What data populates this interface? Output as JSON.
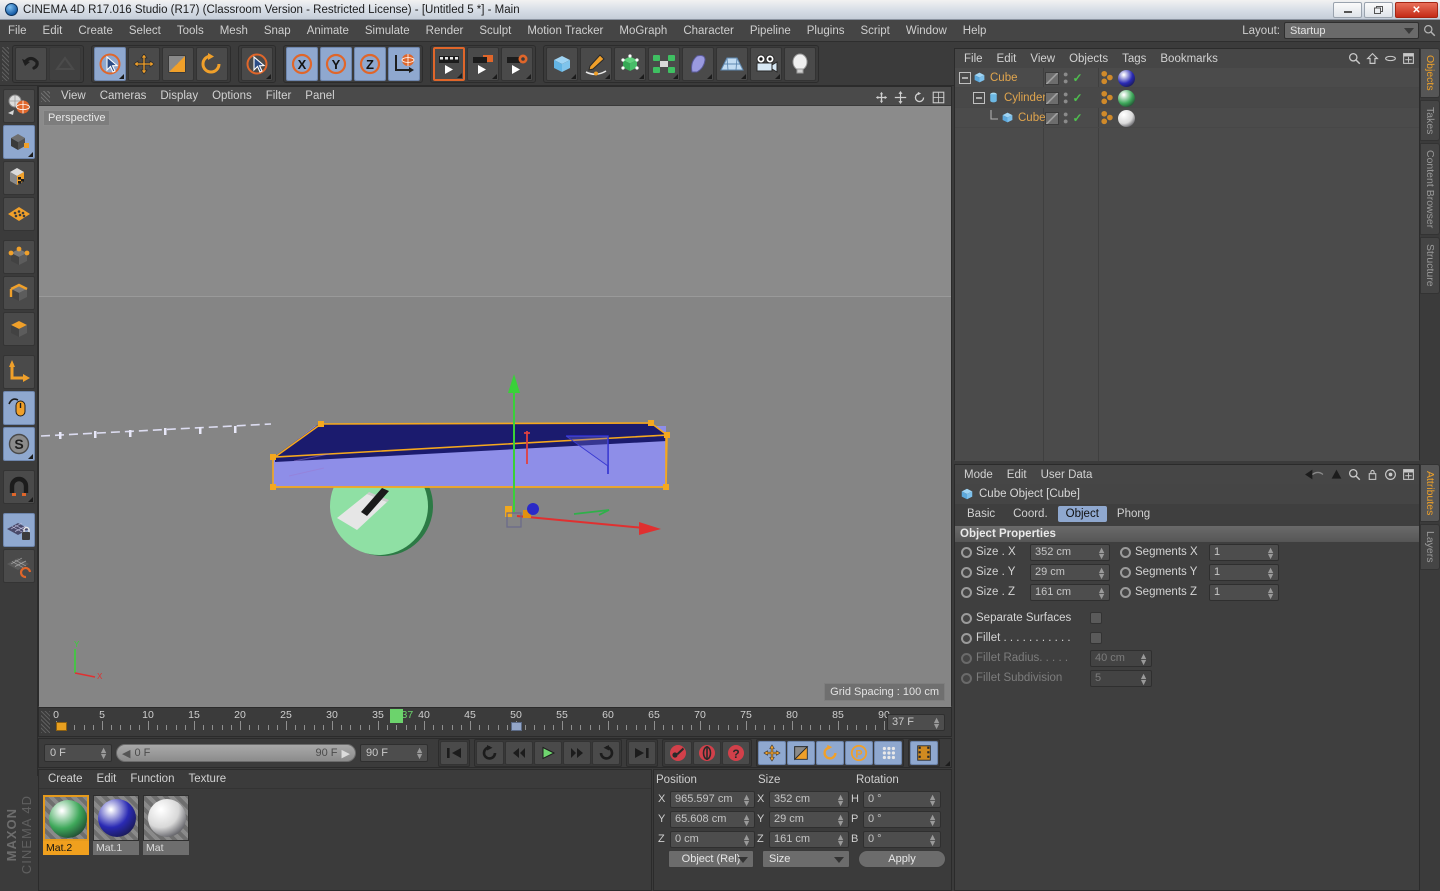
{
  "window": {
    "title": "CINEMA 4D R17.016 Studio (R17) (Classroom Version - Restricted License) - [Untitled 5 *] - Main",
    "minimize": "—",
    "restore": "❐",
    "close": "✕"
  },
  "menubar": {
    "items": [
      "File",
      "Edit",
      "Create",
      "Select",
      "Tools",
      "Mesh",
      "Snap",
      "Animate",
      "Simulate",
      "Render",
      "Sculpt",
      "Motion Tracker",
      "MoGraph",
      "Character",
      "Pipeline",
      "Plugins",
      "Script",
      "Window",
      "Help"
    ],
    "layout_label": "Layout:",
    "layout_value": "Startup"
  },
  "toolbar": {
    "undo": "undo-icon",
    "redo": "redo-icon",
    "select": "live-selection-icon",
    "move": "move-icon",
    "scale": "scale-icon",
    "rotate": "rotate-icon",
    "cursor": "cursor-icon",
    "axis_x": "X",
    "axis_y": "Y",
    "axis_z": "Z",
    "world": "world-axis-icon",
    "render_view": "render-view-icon",
    "render_region": "render-region-icon",
    "render_settings": "render-settings-icon",
    "cube": "cube-primitive-icon",
    "pen": "spline-pen-icon",
    "nurbs": "generator-icon",
    "mograph": "array-icon",
    "deformer": "bend-deformer-icon",
    "scene": "floor-icon",
    "camera": "camera-icon",
    "light": "light-icon"
  },
  "left_tools": [
    {
      "name": "undo-view-icon",
      "active": false
    },
    {
      "name": "model-mode-icon",
      "active": true
    },
    {
      "name": "texture-mode-icon",
      "active": false
    },
    {
      "name": "workplane-icon",
      "active": false
    },
    {
      "name": "points-mode-icon",
      "active": false
    },
    {
      "name": "edges-mode-icon",
      "active": false
    },
    {
      "name": "polygons-mode-icon",
      "active": false
    },
    {
      "name": "axis-modify-icon",
      "active": false
    },
    {
      "name": "enable-snapping-icon",
      "active": true
    },
    {
      "name": "soft-selection-icon",
      "active": true
    },
    {
      "name": "magnet-icon",
      "active": false
    },
    {
      "name": "workplane-lock-icon",
      "active": true
    },
    {
      "name": "workplane-cycle-icon",
      "active": false
    }
  ],
  "viewport": {
    "menus": [
      "View",
      "Cameras",
      "Display",
      "Options",
      "Filter",
      "Panel"
    ],
    "perspective_label": "Perspective",
    "grid_spacing": "Grid Spacing : 100 cm",
    "axis_labels": {
      "y": "Y",
      "x": "X"
    },
    "colors": {
      "cube_top": "#1b1b6e",
      "cube_side": "#8e8ee8",
      "selection_outline": "#f5a81e",
      "cylinder": "#8fe0a4",
      "small_cube": "#e8e8e8",
      "axis_y": "#39d139",
      "axis_x": "#e03030",
      "axis_z": "#3030e0"
    }
  },
  "timeline": {
    "ticks": [
      0,
      5,
      10,
      15,
      20,
      25,
      30,
      35,
      40,
      45,
      50,
      55,
      60,
      65,
      70,
      75,
      80,
      85,
      90
    ],
    "playhead_label": "37",
    "current_frame_field": "37 F",
    "range_start": 0,
    "range_end": 90
  },
  "transport": {
    "start_field": "0 F",
    "scrub_left": "0 F",
    "scrub_right": "90 F",
    "end_field": "90 F",
    "buttons": [
      {
        "name": "go-to-start-button",
        "glyph": "⏮"
      },
      {
        "name": "play-reverse-loop-button",
        "glyph": "↺"
      },
      {
        "name": "step-back-button",
        "glyph": "◀|"
      },
      {
        "name": "play-button",
        "glyph": "▶"
      },
      {
        "name": "step-forward-button",
        "glyph": "|▶"
      },
      {
        "name": "loop-button",
        "glyph": "↻"
      },
      {
        "name": "go-to-end-button",
        "glyph": "⏭"
      },
      {
        "name": "record-key-button",
        "glyph": "key"
      },
      {
        "name": "autokey-button",
        "glyph": "circle"
      },
      {
        "name": "keyframe-help-button",
        "glyph": "?"
      },
      {
        "name": "key-position-button",
        "glyph": "move"
      },
      {
        "name": "key-scale-button",
        "glyph": "scale"
      },
      {
        "name": "key-rotation-button",
        "glyph": "rotate"
      },
      {
        "name": "key-param-button",
        "glyph": "P"
      },
      {
        "name": "key-pla-button",
        "glyph": "dots"
      },
      {
        "name": "timeline-button",
        "glyph": "film"
      }
    ]
  },
  "material_manager": {
    "menus": [
      "Create",
      "Edit",
      "Function",
      "Texture"
    ],
    "materials": [
      {
        "name": "Mat.2",
        "color": "#3ea85a",
        "selected": true
      },
      {
        "name": "Mat.1",
        "color": "#2a2ab4",
        "selected": false
      },
      {
        "name": "Mat",
        "color": "#d8d8d8",
        "selected": false
      }
    ]
  },
  "coordinates": {
    "headers": [
      "Position",
      "Size",
      "Rotation"
    ],
    "position": {
      "x_label": "X",
      "x": "965.597 cm",
      "y_label": "Y",
      "y": "65.608 cm",
      "z_label": "Z",
      "z": "0 cm"
    },
    "size": {
      "x_label": "X",
      "x": "352 cm",
      "y_label": "Y",
      "y": "29 cm",
      "z_label": "Z",
      "z": "161 cm"
    },
    "rotation": {
      "h_label": "H",
      "h": "0 °",
      "p_label": "P",
      "p": "0 °",
      "b_label": "B",
      "b": "0 °"
    },
    "mode_dropdown": "Object (Rel)",
    "size_dropdown": "Size",
    "apply_button": "Apply"
  },
  "object_manager": {
    "menus": [
      "File",
      "Edit",
      "View",
      "Objects",
      "Tags",
      "Bookmarks"
    ],
    "objects": [
      {
        "name": "Cube",
        "depth": 0,
        "expander": "−",
        "icon": "cube-icon",
        "mat_color": "#2a2ab4",
        "visible": true
      },
      {
        "name": "Cylinder",
        "depth": 1,
        "expander": "−",
        "icon": "cylinder-icon",
        "mat_color": "#3ea85a",
        "visible": true
      },
      {
        "name": "Cube",
        "depth": 2,
        "expander": "└",
        "icon": "cube-icon",
        "mat_color": "#dadada",
        "visible": true
      }
    ]
  },
  "attribute_manager": {
    "menus": [
      "Mode",
      "Edit",
      "User Data"
    ],
    "object_title": "Cube Object [Cube]",
    "tabs": [
      {
        "label": "Basic",
        "active": false
      },
      {
        "label": "Coord.",
        "active": false
      },
      {
        "label": "Object",
        "active": true
      },
      {
        "label": "Phong",
        "active": false
      }
    ],
    "section_title": "Object Properties",
    "properties": [
      {
        "label": "Size . X",
        "value": "352 cm",
        "label2": "Segments X",
        "value2": "1",
        "disabled": false
      },
      {
        "label": "Size . Y",
        "value": "29 cm",
        "label2": "Segments Y",
        "value2": "1",
        "disabled": false
      },
      {
        "label": "Size . Z",
        "value": "161 cm",
        "label2": "Segments Z",
        "value2": "1",
        "disabled": false
      }
    ],
    "checkboxes": [
      {
        "label": "Separate Surfaces",
        "checked": false,
        "disabled": false
      },
      {
        "label": "Fillet . . . . . . . . . . .",
        "checked": false,
        "disabled": false
      }
    ],
    "fillet_fields": [
      {
        "label": "Fillet Radius. . . . .",
        "value": "40 cm",
        "disabled": true
      },
      {
        "label": "Fillet Subdivision",
        "value": "5",
        "disabled": true
      }
    ]
  },
  "right_tabs": {
    "top": [
      {
        "label": "Objects",
        "active": true
      },
      {
        "label": "Takes",
        "active": false
      },
      {
        "label": "Content Browser",
        "active": false
      },
      {
        "label": "Structure",
        "active": false
      }
    ],
    "bottom": [
      {
        "label": "Attributes",
        "active": true
      },
      {
        "label": "Layers",
        "active": false
      }
    ]
  },
  "brand": {
    "line1": "MAXON",
    "line2": "CINEMA 4D"
  }
}
